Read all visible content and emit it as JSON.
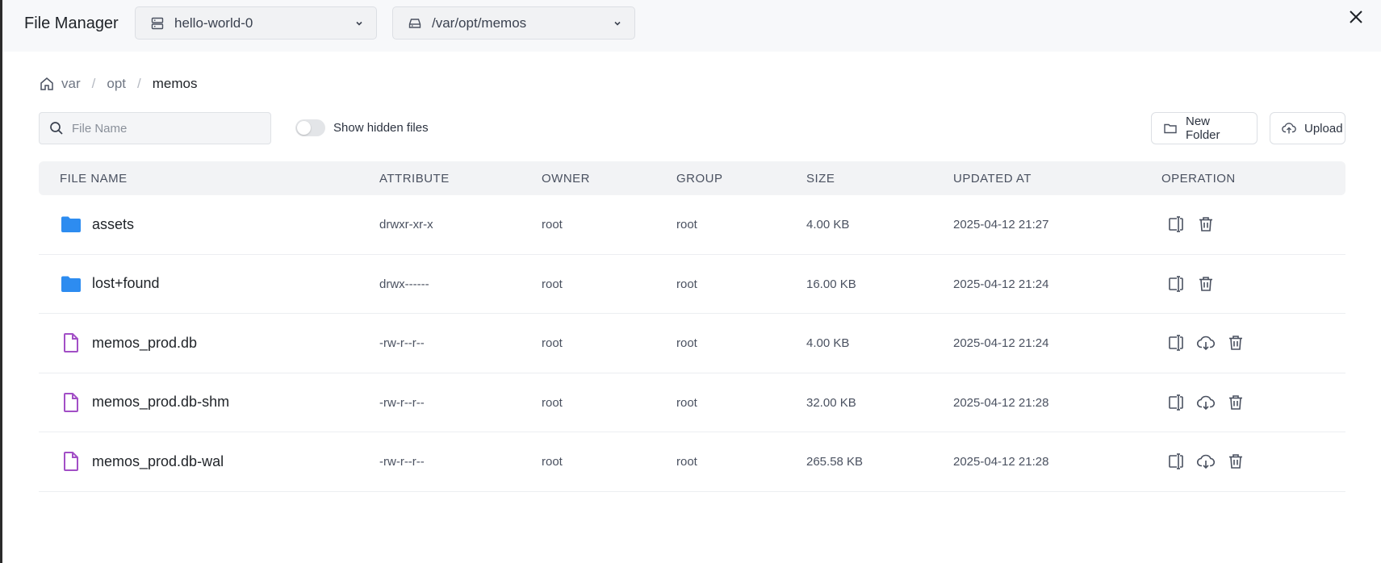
{
  "header": {
    "title": "File Manager",
    "server_select": {
      "value": "hello-world-0",
      "icon": "server-icon"
    },
    "path_select": {
      "value": "/var/opt/memos",
      "icon": "hard-drive-icon"
    },
    "close_icon": "close-icon"
  },
  "breadcrumb": {
    "home_icon": "home-icon",
    "items": [
      "var",
      "opt",
      "memos"
    ],
    "separator": "/"
  },
  "toolbar": {
    "search_placeholder": "File Name",
    "show_hidden_label": "Show hidden files",
    "show_hidden_on": false,
    "new_folder_label": "New Folder",
    "upload_label": "Upload"
  },
  "table": {
    "headers": [
      "FILE NAME",
      "ATTRIBUTE",
      "OWNER",
      "GROUP",
      "SIZE",
      "UPDATED AT",
      "OPERATION"
    ],
    "rows": [
      {
        "name": "assets",
        "type": "folder",
        "attribute": "drwxr-xr-x",
        "owner": "root",
        "group": "root",
        "size": "4.00 KB",
        "updated": "2025-04-12 21:27"
      },
      {
        "name": "lost+found",
        "type": "folder",
        "attribute": "drwx------",
        "owner": "root",
        "group": "root",
        "size": "16.00 KB",
        "updated": "2025-04-12 21:24"
      },
      {
        "name": "memos_prod.db",
        "type": "file",
        "attribute": "-rw-r--r--",
        "owner": "root",
        "group": "root",
        "size": "4.00 KB",
        "updated": "2025-04-12 21:24"
      },
      {
        "name": "memos_prod.db-shm",
        "type": "file",
        "attribute": "-rw-r--r--",
        "owner": "root",
        "group": "root",
        "size": "32.00 KB",
        "updated": "2025-04-12 21:28"
      },
      {
        "name": "memos_prod.db-wal",
        "type": "file",
        "attribute": "-rw-r--r--",
        "owner": "root",
        "group": "root",
        "size": "265.58 KB",
        "updated": "2025-04-12 21:28"
      }
    ]
  },
  "colors": {
    "folder": "#2d8cf0",
    "file": "#a24fc6",
    "icon_gray": "#4a5160"
  }
}
